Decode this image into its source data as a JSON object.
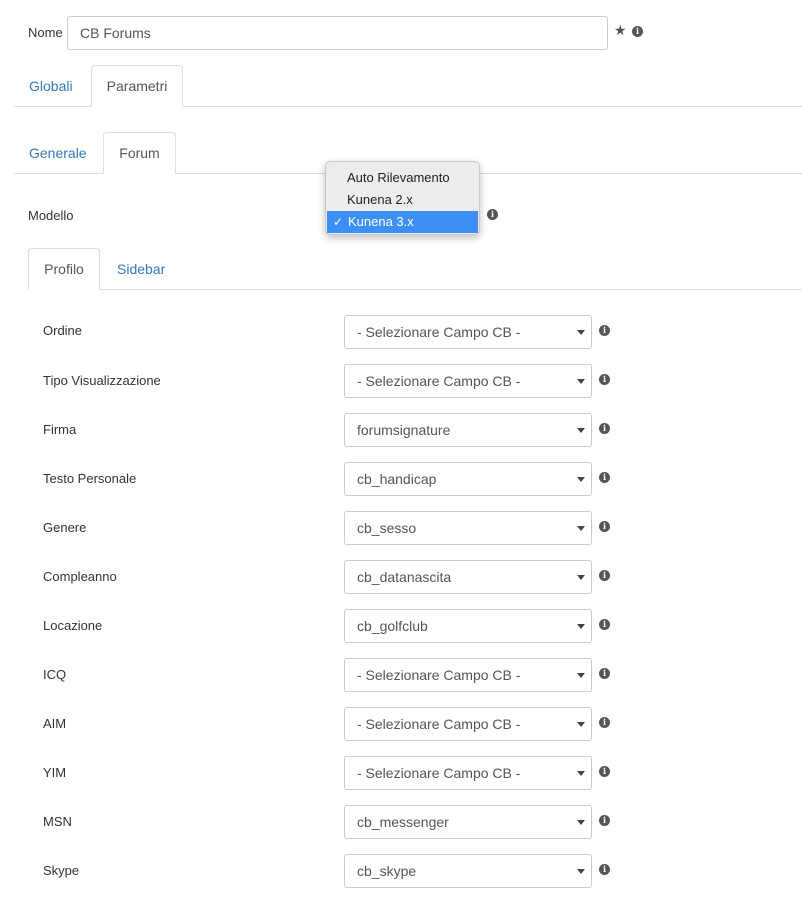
{
  "nome": {
    "label": "Nome",
    "value": "CB Forums"
  },
  "tabs_top": [
    {
      "label": "Globali",
      "active": false
    },
    {
      "label": "Parametri",
      "active": true
    }
  ],
  "tabs_sub": [
    {
      "label": "Generale",
      "active": false
    },
    {
      "label": "Forum",
      "active": true
    }
  ],
  "modello": {
    "label": "Modello",
    "options": [
      "Auto Rilevamento",
      "Kunena 2.x",
      "Kunena 3.x"
    ],
    "selected": "Kunena 3.x",
    "check_glyph": "✓"
  },
  "tabs_inner": [
    {
      "label": "Profilo",
      "active": true
    },
    {
      "label": "Sidebar",
      "active": false
    }
  ],
  "fields": [
    {
      "label": "Ordine",
      "value": "- Selezionare Campo CB -"
    },
    {
      "label": "Tipo Visualizzazione",
      "value": "- Selezionare Campo CB -"
    },
    {
      "label": "Firma",
      "value": "forumsignature"
    },
    {
      "label": "Testo Personale",
      "value": "cb_handicap"
    },
    {
      "label": "Genere",
      "value": "cb_sesso"
    },
    {
      "label": "Compleanno",
      "value": "cb_datanascita"
    },
    {
      "label": "Locazione",
      "value": "cb_golfclub"
    },
    {
      "label": "ICQ",
      "value": "- Selezionare Campo CB -"
    },
    {
      "label": "AIM",
      "value": "- Selezionare Campo CB -"
    },
    {
      "label": "YIM",
      "value": "- Selezionare Campo CB -"
    },
    {
      "label": "MSN",
      "value": "cb_messenger"
    },
    {
      "label": "Skype",
      "value": "cb_skype"
    }
  ],
  "icons": {
    "star": "star-icon",
    "info": "info-icon"
  },
  "colors": {
    "link": "#337ab7",
    "selected_option": "#3d8ff5",
    "border": "#dddddd"
  }
}
